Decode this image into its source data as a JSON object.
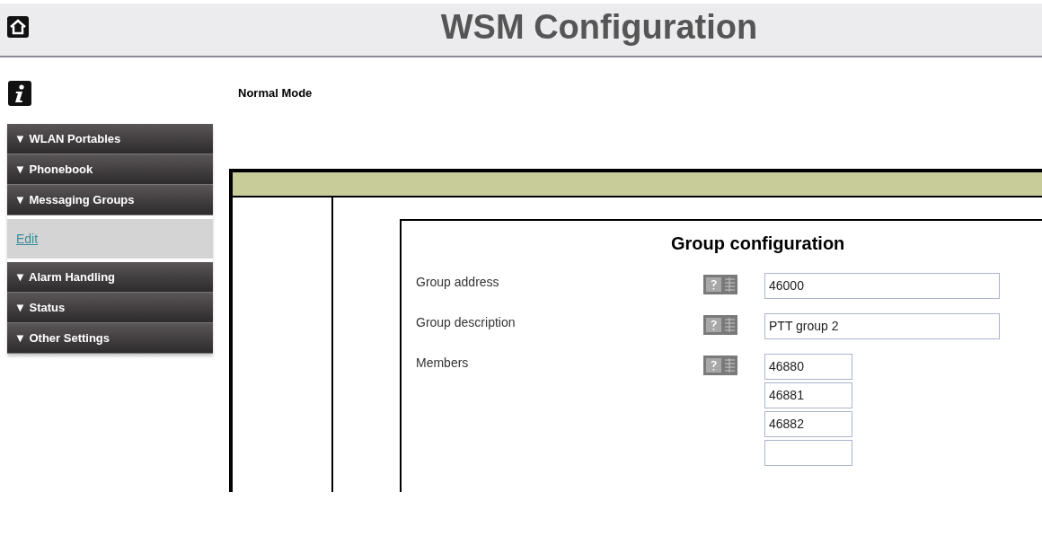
{
  "header": {
    "title": "WSM Configuration"
  },
  "mode": "Normal Mode",
  "sidebar": {
    "items": [
      {
        "kind": "section",
        "label": "▼ WLAN Portables"
      },
      {
        "kind": "section",
        "label": "▼ Phonebook"
      },
      {
        "kind": "section",
        "label": "▼ Messaging Groups"
      },
      {
        "kind": "link",
        "label": "Edit"
      },
      {
        "kind": "section",
        "label": "▼ Alarm Handling"
      },
      {
        "kind": "section",
        "label": "▼ Status"
      },
      {
        "kind": "section",
        "label": "▼ Other Settings"
      }
    ]
  },
  "form": {
    "title": "Group configuration",
    "fields": [
      {
        "label": "Group address",
        "kind": "text",
        "value": "46000"
      },
      {
        "label": "Group description",
        "kind": "text",
        "value": "PTT group 2"
      },
      {
        "label": "Members",
        "kind": "list",
        "values": [
          "46880",
          "46881",
          "46882"
        ]
      }
    ]
  }
}
